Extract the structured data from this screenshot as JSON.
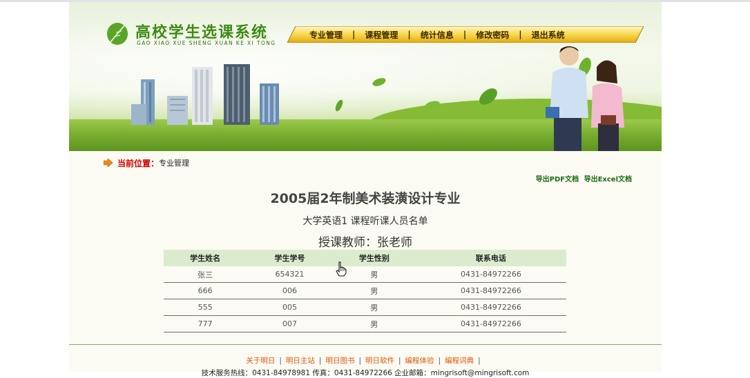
{
  "app": {
    "logo_title": "高校学生选课系统",
    "logo_subtitle": "GAO XIAO XUE SHENG XUAN KE XI TONG"
  },
  "nav": {
    "items": [
      "专业管理",
      "课程管理",
      "统计信息",
      "修改密码",
      "退出系统"
    ],
    "separator": "|"
  },
  "breadcrumb": {
    "label": "当前位置：",
    "value": "专业管理"
  },
  "export": {
    "pdf": "导出PDF文档",
    "excel": "导出Excel文档"
  },
  "report": {
    "major": "2005届2年制美术装潢设计专业",
    "course": "大学英语1 课程听课人员名单",
    "teacher": "授课教师：张老师"
  },
  "table": {
    "headers": [
      "学生姓名",
      "学生学号",
      "学生性别",
      "联系电话"
    ],
    "rows": [
      [
        "张三",
        "654321",
        "男",
        "0431-84972266"
      ],
      [
        "666",
        "006",
        "男",
        "0431-84972266"
      ],
      [
        "555",
        "005",
        "男",
        "0431-84972266"
      ],
      [
        "777",
        "007",
        "男",
        "0431-84972266"
      ]
    ]
  },
  "footer": {
    "links": [
      "关于明日",
      "明日主站",
      "明日图书",
      "明日软件",
      "编程体验",
      "编程词典"
    ],
    "separator": "|",
    "contact": "技术服务热线：0431-84978981  传真：0431-84972266  企业邮箱：mingrisoft@mingrisoft.com"
  },
  "colors": {
    "accent_red": "#d10000",
    "export_green": "#1d6b12",
    "table_header": "#dbecce",
    "footer_link": "#e0560d"
  }
}
